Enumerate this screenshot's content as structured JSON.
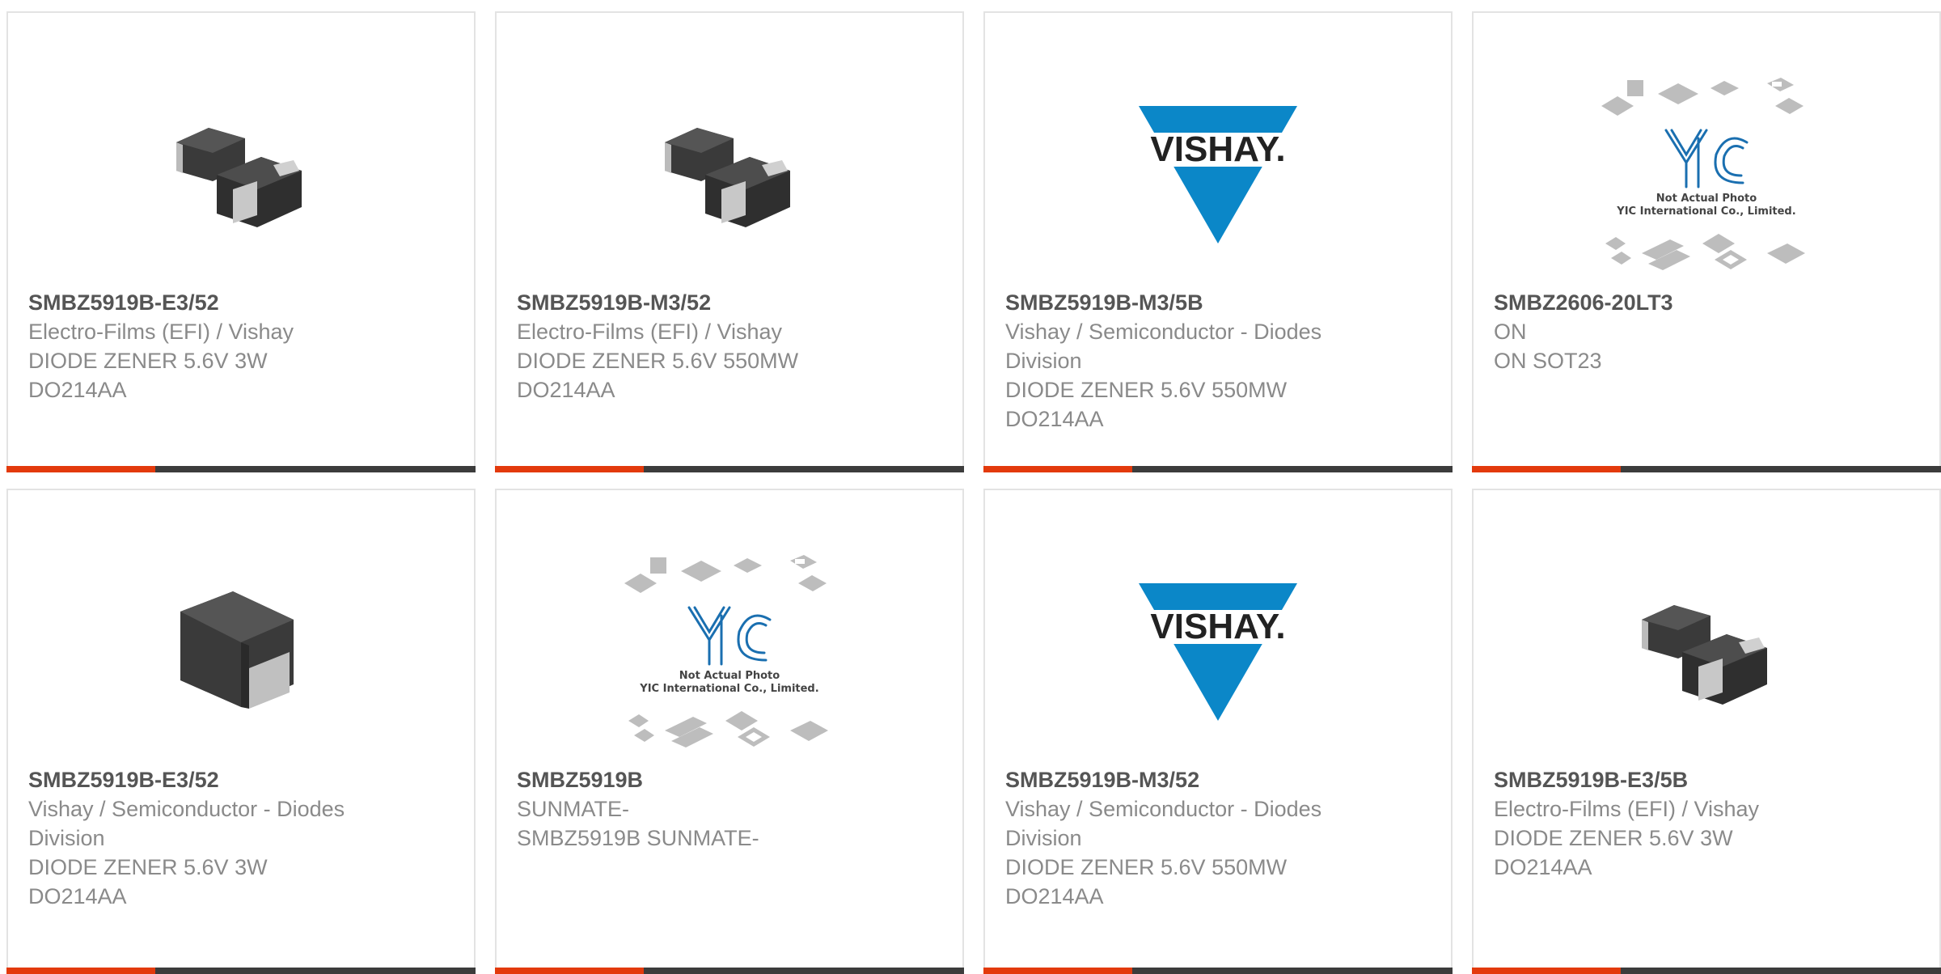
{
  "cards": [
    {
      "part_number": "SMBZ5919B-E3/52",
      "lines": [
        "Electro-Films (EFI) / Vishay",
        "DIODE ZENER 5.6V 3W",
        "DO214AA"
      ],
      "image": "smb-two-diodes-icon"
    },
    {
      "part_number": "SMBZ5919B-M3/52",
      "lines": [
        "Electro-Films (EFI) / Vishay",
        "DIODE ZENER 5.6V 550MW",
        "DO214AA"
      ],
      "image": "smb-two-diodes-icon"
    },
    {
      "part_number": "SMBZ5919B-M3/5B",
      "lines": [
        "Vishay / Semiconductor - Diodes",
        "Division",
        "DIODE ZENER 5.6V 550MW",
        "DO214AA"
      ],
      "image": "vishay-logo"
    },
    {
      "part_number": "SMBZ2606-20LT3",
      "lines": [
        "ON",
        "ON SOT23"
      ],
      "image": "yic-placeholder"
    },
    {
      "part_number": "SMBZ5919B-E3/52",
      "lines": [
        "Vishay / Semiconductor - Diodes",
        "Division",
        "DIODE ZENER 5.6V 3W",
        "DO214AA"
      ],
      "image": "smb-single-diode-icon"
    },
    {
      "part_number": "SMBZ5919B",
      "lines": [
        "SUNMATE-",
        "SMBZ5919B SUNMATE-"
      ],
      "image": "yic-placeholder"
    },
    {
      "part_number": "SMBZ5919B-M3/52",
      "lines": [
        "Vishay / Semiconductor - Diodes",
        "Division",
        "DIODE ZENER 5.6V 550MW",
        "DO214AA"
      ],
      "image": "vishay-logo"
    },
    {
      "part_number": "SMBZ5919B-E3/5B",
      "lines": [
        "Electro-Films (EFI) / Vishay",
        "DIODE ZENER 5.6V 3W",
        "DO214AA"
      ],
      "image": "smb-two-diodes-icon"
    }
  ],
  "logos": {
    "vishay": "VISHAY.",
    "yic": "YIC",
    "yic_note_1": "Not Actual Photo",
    "yic_note_2": "YIC International Co., Limited."
  },
  "colors": {
    "accent": "#e33a0c",
    "bar": "#3c3c3c",
    "vishay_blue": "#0b87c8",
    "yic_blue": "#1a6fb0"
  }
}
